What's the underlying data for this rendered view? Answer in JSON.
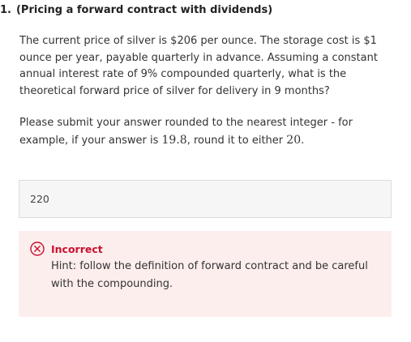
{
  "question": {
    "number": "1.",
    "title": "(Pricing a forward contract with dividends)",
    "body": "The current price of silver is $206 per ounce. The storage cost is $1 ounce per year, payable quarterly in advance. Assuming a constant annual interest rate of 9% compounded quarterly, what is the theoretical forward price of silver for delivery in 9 months?",
    "instruction_prefix": "Please submit your answer rounded to the nearest integer - for example, if your answer is ",
    "example_value": "19.8",
    "instruction_middle": ", round it to either ",
    "rounded_value": "20",
    "instruction_suffix": "."
  },
  "answer": {
    "value": "220"
  },
  "feedback": {
    "status": "Incorrect",
    "hint": "Hint: follow the definition of forward contract and be careful with the compounding.",
    "icon": "x-circle-icon",
    "accent_color": "#c8102e",
    "background_color": "#fdeeee"
  }
}
